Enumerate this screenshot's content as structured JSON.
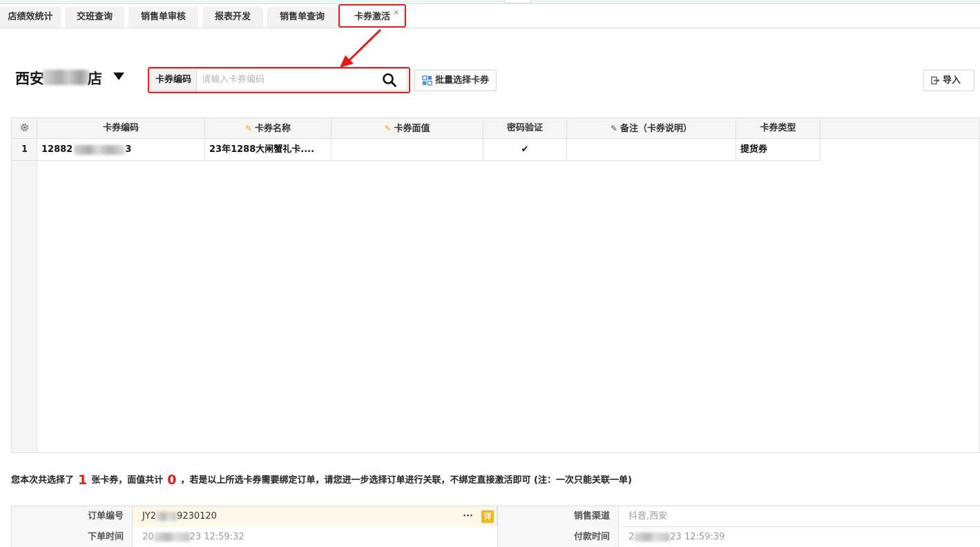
{
  "tabs": [
    {
      "label": "店绩效统计"
    },
    {
      "label": "交班查询"
    },
    {
      "label": "销售单审核"
    },
    {
      "label": "报表开发"
    },
    {
      "label": "销售单查询"
    },
    {
      "label": "卡券激活",
      "close": "×"
    }
  ],
  "store": {
    "prefix": "西安",
    "suffix": "店"
  },
  "search": {
    "label": "卡券编码",
    "placeholder": "请输入卡券编码",
    "value": ""
  },
  "toolbar": {
    "batch_label": "批量选择卡券",
    "import_label": "导入"
  },
  "table": {
    "headers": [
      "卡券编码",
      "卡券名称",
      "卡券面值",
      "密码验证",
      "备注（卡券说明）",
      "卡券类型"
    ],
    "rows": [
      {
        "index": "1",
        "code_visible": "12882",
        "code_tail": "3",
        "name": "23年1288大闸蟹礼卡....",
        "value": "",
        "pwd_check": "✔",
        "remark": "",
        "type": "提货券"
      }
    ]
  },
  "summary": {
    "pre": "您本次共选择了",
    "count": "1",
    "mid": "张卡券，面值共计",
    "total": "0",
    "post": "，若是以上所选卡券需要绑定订单，请您进一步选择订单进行关联，不绑定直接激活即可 (注：一次只能关联一单)"
  },
  "form": {
    "order_no_label": "订单编号",
    "order_no_prefix": "JY2",
    "order_no_suffix": "9230120",
    "more": "···",
    "detail_badge": "详",
    "channel_label": "销售渠道",
    "channel_value": "抖音,西安",
    "order_time_label": "下单时间",
    "order_time_prefix": "20",
    "order_time_suffix": "23 12:59:32",
    "pay_time_label": "付款时间",
    "pay_time_prefix": "2",
    "pay_time_suffix": "23 12:59:39"
  },
  "colors": {
    "accent_red": "#e21b1b",
    "badge_yellow": "#f2b51f",
    "pen_orange": "#f0a81c"
  }
}
